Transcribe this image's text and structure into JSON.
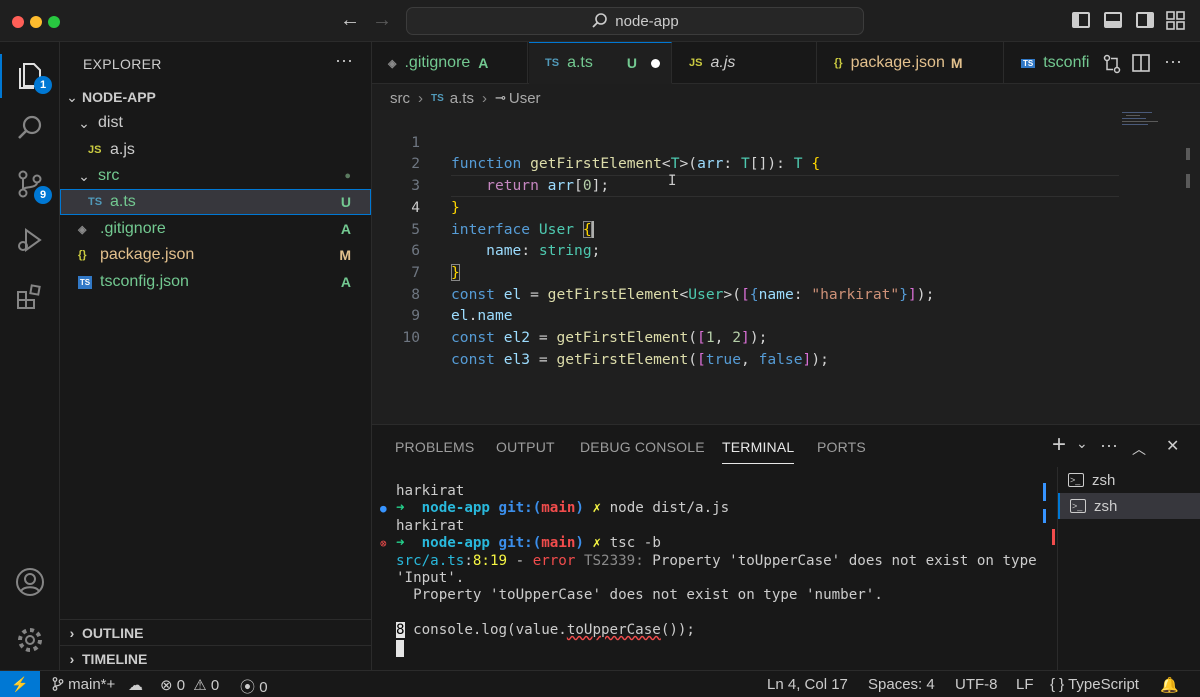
{
  "title": "node-app",
  "colors": {
    "accent": "#0078d4",
    "added": "#73c991",
    "modified": "#e2c08d",
    "error": "#f14c4c",
    "ts_icon": "#519aba",
    "js_icon": "#cbcb41"
  },
  "activity": {
    "explorer_badge": "1",
    "scm_badge": "9"
  },
  "explorer": {
    "header": "EXPLORER",
    "more": "···",
    "project": "NODE-APP",
    "tree": [
      {
        "name": "dist",
        "icon": "",
        "status": ""
      },
      {
        "name": "a.js",
        "icon": "JS",
        "status": ""
      },
      {
        "name": "src",
        "icon": "",
        "status": "●"
      },
      {
        "name": "a.ts",
        "icon": "TS",
        "status": "U"
      },
      {
        "name": ".gitignore",
        "icon": "◈",
        "status": "A"
      },
      {
        "name": "package.json",
        "icon": "{}",
        "status": "M"
      },
      {
        "name": "tsconfig.json",
        "icon": "TS",
        "status": "A"
      }
    ],
    "outline": "OUTLINE",
    "timeline": "TIMELINE"
  },
  "tabs": [
    {
      "icon": "◈",
      "label": ".gitignore",
      "status": "A"
    },
    {
      "icon": "TS",
      "label": "a.ts",
      "status": "U"
    },
    {
      "icon": "JS",
      "label": "a.js",
      "status": ""
    },
    {
      "icon": "{}",
      "label": "package.json",
      "status": "M"
    },
    {
      "icon": "TS",
      "label": "tsconfi",
      "status": ""
    }
  ],
  "breadcrumb": {
    "folder": "src",
    "file_icon": "TS",
    "file": "a.ts",
    "symbol": "User"
  },
  "code": {
    "line_numbers": [
      "1",
      "2",
      "3",
      "4",
      "5",
      "6",
      "7",
      "8",
      "9",
      "10"
    ],
    "l1": {
      "a": "function",
      "b": "getFirstElement",
      "c": "<",
      "d": "T",
      "e": ">(",
      "f": "arr",
      "g": ": ",
      "h": "T",
      "i": "[]): ",
      "j": "T",
      "k": " {"
    },
    "l2": {
      "a": "return",
      "b": "arr",
      "c": "[",
      "d": "0",
      "e": "];"
    },
    "l3": {
      "a": "}"
    },
    "l4": {
      "a": "interface",
      "b": "User",
      "c": "{"
    },
    "l5": {
      "a": "name",
      "b": ": ",
      "c": "string",
      "d": ";"
    },
    "l6": {
      "a": "}"
    },
    "l7": {
      "a": "const",
      "b": "el",
      "c": " = ",
      "d": "getFirstElement",
      "e": "<",
      "f": "User",
      "g": ">(",
      "h": "[",
      "i": "{",
      "j": "name",
      "k": ": ",
      "l": "\"harkirat\"",
      "m": "}",
      "n": "]",
      "o": ");"
    },
    "l8": {
      "a": "el",
      "b": ".",
      "c": "name"
    },
    "l9": {
      "a": "const",
      "b": "el2",
      "c": " = ",
      "d": "getFirstElement",
      "e": "(",
      "f": "[",
      "g": "1",
      "h": ", ",
      "i": "2",
      "j": "]",
      "k": ");"
    },
    "l10": {
      "a": "const",
      "b": "el3",
      "c": " = ",
      "d": "getFirstElement",
      "e": "(",
      "f": "[",
      "g": "true",
      "h": ", ",
      "i": "false",
      "j": "]",
      "k": ");"
    }
  },
  "panel": {
    "tabs": [
      "PROBLEMS",
      "OUTPUT",
      "DEBUG CONSOLE",
      "TERMINAL",
      "PORTS"
    ],
    "plus": "+",
    "chevron": "⌄",
    "more": "···",
    "up": "︿",
    "close": "✕"
  },
  "terminal": {
    "t1": "harkirat",
    "t2_arrow": "➜",
    "t2_dir": "node-app",
    "t2_git": "git:(",
    "t2_branch": "main",
    "t2_close": ")",
    "t2_x": "✗",
    "t2_cmd": "node dist/a.js",
    "t3": "harkirat",
    "t4_arrow": "➜",
    "t4_dir": "node-app",
    "t4_git": "git:(",
    "t4_branch": "main",
    "t4_close": ")",
    "t4_x": "✗",
    "t4_cmd": "tsc -b",
    "t5_file": "src/a.ts",
    "t5_colon": ":",
    "t5_pos": "8:19",
    "t5_dash": " - ",
    "t5_err": "error",
    "t5_code": "TS2339:",
    "t5_msg": "Property 'toUpperCase' does not exist on type",
    "t6": "'Input'.",
    "t7": "  Property 'toUpperCase' does not exist on type 'number'.",
    "t9_num": "8",
    "t9_code": "console.log(value.",
    "t9_err": "toUpperCase",
    "t9_end": "());",
    "sessions": [
      "zsh",
      "zsh"
    ]
  },
  "status": {
    "remote": "⚡",
    "branch": "main*+",
    "errors": "0",
    "warnings": "0",
    "ports": "0",
    "position": "Ln 4, Col 17",
    "spaces": "Spaces: 4",
    "encoding": "UTF-8",
    "eol": "LF",
    "lang_braces": "{ }",
    "language": "TypeScript"
  }
}
